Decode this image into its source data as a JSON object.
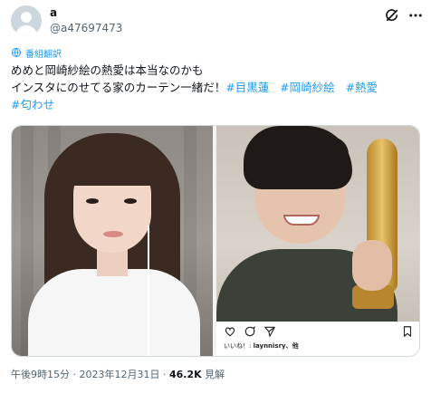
{
  "header": {
    "display_name": "a",
    "handle": "@a47697473",
    "avatar": "default-avatar",
    "icons": [
      "grok-icon",
      "more-icon"
    ]
  },
  "translate": {
    "label": "番組翻訳",
    "icon": "globe-icon",
    "color": "#1d9bf0"
  },
  "tweet": {
    "line1": "めめと岡崎紗絵の熱愛は本当なのかも",
    "line2_text": "インスタにのせてる家のカーテン一緒だ！",
    "tags": [
      "#目黒蓮",
      "#岡崎紗絵",
      "#熱愛",
      "#匂わせ"
    ]
  },
  "media": {
    "instagram": {
      "likes_prefix": "いいね！:",
      "likes_users": "laynnisry、他",
      "icons": [
        "heart-icon",
        "comment-icon",
        "share-icon",
        "bookmark-icon"
      ]
    }
  },
  "meta": {
    "time": "午後9時15分",
    "separator1": "·",
    "date": "2023年12月31日",
    "separator2": "·",
    "views": "46.2K",
    "views_label": "見解"
  },
  "colors": {
    "link": "#1d9bf0",
    "text": "#0f1419",
    "secondary": "#536471"
  }
}
